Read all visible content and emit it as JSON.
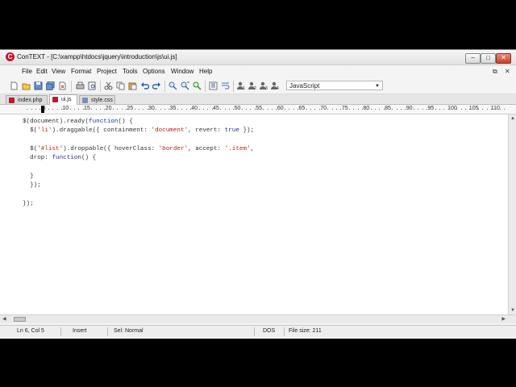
{
  "window": {
    "title": "ConTEXT - [C:\\xampp\\htdocs\\jquery\\introduction\\js\\ui.js]",
    "logo_letter": "C",
    "controls": {
      "minimize": "–",
      "maximize": "□",
      "close": "✕"
    }
  },
  "menubar": {
    "items": [
      "File",
      "Edit",
      "View",
      "Format",
      "Project",
      "Tools",
      "Options",
      "Window",
      "Help"
    ],
    "doc_controls": {
      "restore": "⧉",
      "close": "✕"
    }
  },
  "toolbar": {
    "language": "JavaScript",
    "buttons": [
      "new-file-icon",
      "open-file-icon",
      "save-icon",
      "save-all-icon",
      "close-file-icon",
      "print-icon",
      "print-preview-icon",
      "cut-icon",
      "copy-icon",
      "paste-icon",
      "undo-icon",
      "redo-icon",
      "find-icon",
      "find-next-icon",
      "replace-icon",
      "toggle-line-numbers-icon",
      "word-wrap-icon",
      "user-exec-1-icon",
      "user-exec-2-icon",
      "user-exec-3-icon",
      "user-exec-4-icon"
    ]
  },
  "tabs": [
    {
      "label": "index.php",
      "icon_color": "#b71c2c"
    },
    {
      "label": "ui.js",
      "icon_color": "#b71c2c"
    },
    {
      "label": "style.css",
      "icon_color": "#7a8fb5"
    }
  ],
  "active_tab": 1,
  "ruler": {
    "numbers": [
      "5",
      "10",
      "15",
      "20",
      "25",
      "30",
      "35",
      "40",
      "45",
      "50",
      "55",
      "60",
      "65",
      "70",
      "75",
      "80",
      "85",
      "90",
      "95",
      "100",
      "105",
      "110"
    ]
  },
  "code": {
    "lines": [
      [
        {
          "t": "$(document).ready(",
          "c": "pn"
        },
        {
          "t": "function",
          "c": "kw"
        },
        {
          "t": "() {",
          "c": "pn"
        }
      ],
      [
        {
          "t": "  $(",
          "c": "pn"
        },
        {
          "t": "'li'",
          "c": "str"
        },
        {
          "t": ").draggable({ containment: ",
          "c": "pn"
        },
        {
          "t": "'document'",
          "c": "str"
        },
        {
          "t": ", revert: ",
          "c": "pn"
        },
        {
          "t": "true",
          "c": "kw"
        },
        {
          "t": " });",
          "c": "pn"
        }
      ],
      [],
      [
        {
          "t": "  $(",
          "c": "pn"
        },
        {
          "t": "'#list'",
          "c": "str"
        },
        {
          "t": ").droppable({ hoverClass: ",
          "c": "pn"
        },
        {
          "t": "'border'",
          "c": "str"
        },
        {
          "t": ", accept: ",
          "c": "pn"
        },
        {
          "t": "'.item'",
          "c": "str"
        },
        {
          "t": ",",
          "c": "pn"
        }
      ],
      [
        {
          "t": "  drop: ",
          "c": "pn"
        },
        {
          "t": "function",
          "c": "kw"
        },
        {
          "t": "() {",
          "c": "pn"
        }
      ],
      [],
      [
        {
          "t": "  }",
          "c": "pn"
        }
      ],
      [
        {
          "t": "  });",
          "c": "pn"
        }
      ],
      [],
      [
        {
          "t": "});",
          "c": "pn"
        }
      ]
    ]
  },
  "statusbar": {
    "position": "Ln 6, Col 5",
    "mode": "Insert",
    "selection": "Sel: Normal",
    "line_endings": "DOS",
    "file_size": "File size: 211"
  }
}
